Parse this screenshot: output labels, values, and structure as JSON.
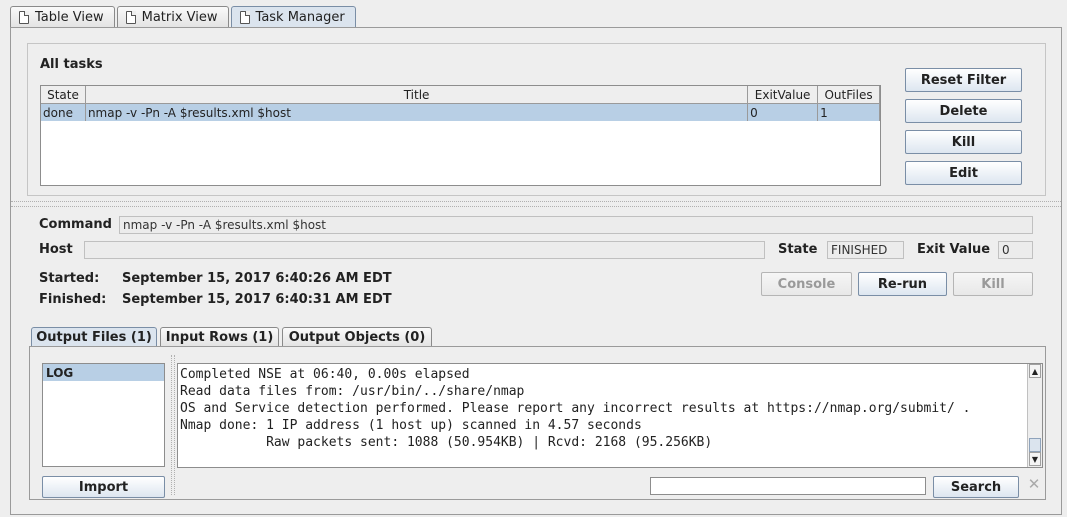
{
  "tabs": [
    {
      "label": "Table View",
      "icon": "document-icon"
    },
    {
      "label": "Matrix View",
      "icon": "document-icon"
    },
    {
      "label": "Task Manager",
      "icon": "document-icon",
      "active": true
    }
  ],
  "all_tasks": {
    "title": "All tasks",
    "columns": [
      "State",
      "Title",
      "ExitValue",
      "OutFiles"
    ],
    "rows": [
      {
        "state": "done",
        "title": "nmap -v -Pn -A $results.xml $host",
        "exit_value": "0",
        "out_files": "1"
      }
    ],
    "buttons": {
      "reset_filter": "Reset Filter",
      "delete": "Delete",
      "kill": "Kill",
      "edit": "Edit"
    }
  },
  "details": {
    "command_label": "Command",
    "command_value": "nmap -v -Pn -A $results.xml $host",
    "host_label": "Host",
    "host_value": "",
    "state_label": "State",
    "state_value": "FINISHED",
    "exit_value_label": "Exit Value",
    "exit_value": "0",
    "started_label": "Started:",
    "started_value": "September 15, 2017 6:40:26 AM EDT",
    "finished_label": "Finished:",
    "finished_value": "September 15, 2017 6:40:31 AM EDT",
    "buttons": {
      "console": "Console",
      "rerun": "Re-run",
      "kill": "Kill"
    }
  },
  "output_tabs": [
    {
      "label": "Output Files (1)",
      "active": true
    },
    {
      "label": "Input Rows (1)"
    },
    {
      "label": "Output Objects (0)"
    }
  ],
  "output": {
    "files": [
      "LOG"
    ],
    "import_label": "Import",
    "log_lines": [
      "Completed NSE at 06:40, 0.00s elapsed",
      "Read data files from: /usr/bin/../share/nmap",
      "OS and Service detection performed. Please report any incorrect results at https://nmap.org/submit/ .",
      "Nmap done: 1 IP address (1 host up) scanned in 4.57 seconds",
      "           Raw packets sent: 1088 (50.954KB) | Rcvd: 2168 (95.256KB)"
    ],
    "search_value": "",
    "search_label": "Search"
  },
  "colors": {
    "selection": "#b8cfe5",
    "accent_border": "#7a8ea6"
  }
}
